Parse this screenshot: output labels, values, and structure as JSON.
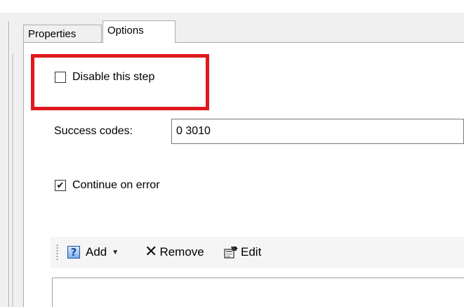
{
  "tabs": [
    {
      "label": "Properties",
      "selected": false
    },
    {
      "label": "Options",
      "selected": true
    }
  ],
  "options": {
    "disable_step": {
      "label": "Disable this step",
      "checked": false
    },
    "success_codes": {
      "label": "Success codes:",
      "value": "0 3010"
    },
    "continue_on_error": {
      "label": "Continue on error",
      "checked": true
    }
  },
  "toolbar": {
    "add_label": "Add",
    "remove_label": "Remove",
    "edit_label": "Edit"
  },
  "icons": {
    "help": "help-icon",
    "remove": "x-icon",
    "edit": "edit-properties-icon"
  },
  "colors": {
    "highlight": "#e0181f",
    "panel_bg": "#f0f0f0"
  }
}
